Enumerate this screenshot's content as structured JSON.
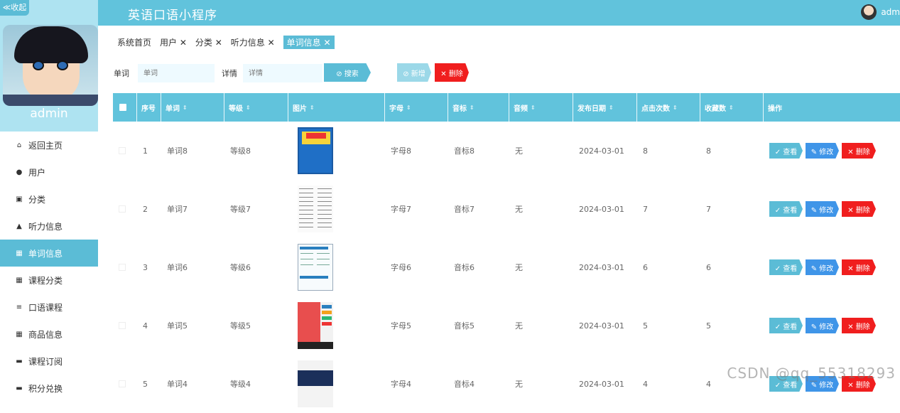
{
  "app_title": "英语口语小程序",
  "user_name": "admin",
  "header_user_visible": "adm",
  "sidebar": {
    "collapse_label": "≪收起",
    "admin_name": "admin",
    "items": [
      {
        "label": "返回主页",
        "icon": "home-icon",
        "glyph": "⌂"
      },
      {
        "label": "用户",
        "icon": "user-pin-icon",
        "glyph": "●"
      },
      {
        "label": "分类",
        "icon": "calendar-icon",
        "glyph": "▣"
      },
      {
        "label": "听力信息",
        "icon": "person-icon",
        "glyph": "▲"
      },
      {
        "label": "单词信息",
        "icon": "grid-icon",
        "glyph": "▦"
      },
      {
        "label": "课程分类",
        "icon": "grid-icon",
        "glyph": "▦"
      },
      {
        "label": "口语课程",
        "icon": "menu-lines-icon",
        "glyph": "≡"
      },
      {
        "label": "商品信息",
        "icon": "grid-icon",
        "glyph": "▦"
      },
      {
        "label": "课程订阅",
        "icon": "monitor-icon",
        "glyph": "▬"
      },
      {
        "label": "积分兑换",
        "icon": "list-icon",
        "glyph": "▬"
      }
    ]
  },
  "tabs": [
    {
      "label": "系统首页",
      "closable": false
    },
    {
      "label": "用户 ✕",
      "closable": true
    },
    {
      "label": "分类 ✕",
      "closable": true
    },
    {
      "label": "听力信息 ✕",
      "closable": true
    },
    {
      "label": "单词信息 ✕",
      "closable": true,
      "active": true
    }
  ],
  "search": {
    "word_label": "单词",
    "word_placeholder": "单词",
    "detail_label": "详情",
    "detail_placeholder": "详情",
    "search_btn": "⊘ 搜索",
    "add_btn": "⊘ 新增",
    "delete_btn": "✕ 删除"
  },
  "table": {
    "columns": [
      "序号",
      "单词",
      "等级",
      "图片",
      "字母",
      "音标",
      "音频",
      "发布日期",
      "点击次数",
      "收藏数",
      "操作"
    ],
    "rows": [
      {
        "no": "1",
        "word": "单词8",
        "level": "等级8",
        "letter": "字母8",
        "phonetic": "音标8",
        "audio": "无",
        "date": "2024-03-01",
        "clicks": "8",
        "favs": "8"
      },
      {
        "no": "2",
        "word": "单词7",
        "level": "等级7",
        "letter": "字母7",
        "phonetic": "音标7",
        "audio": "无",
        "date": "2024-03-01",
        "clicks": "7",
        "favs": "7"
      },
      {
        "no": "3",
        "word": "单词6",
        "level": "等级6",
        "letter": "字母6",
        "phonetic": "音标6",
        "audio": "无",
        "date": "2024-03-01",
        "clicks": "6",
        "favs": "6"
      },
      {
        "no": "4",
        "word": "单词5",
        "level": "等级5",
        "letter": "字母5",
        "phonetic": "音标5",
        "audio": "无",
        "date": "2024-03-01",
        "clicks": "5",
        "favs": "5"
      },
      {
        "no": "5",
        "word": "单词4",
        "level": "等级4",
        "letter": "字母4",
        "phonetic": "音标4",
        "audio": "无",
        "date": "2024-03-01",
        "clicks": "4",
        "favs": "4"
      }
    ],
    "ops": {
      "view": "✓ 查看",
      "edit": "✎ 修改",
      "delete": "✕ 删除"
    }
  },
  "watermark": "CSDN @qq_55318293",
  "colors": {
    "primary": "#61c3dc",
    "edit": "#3f95e8",
    "danger": "#f01e1e"
  }
}
